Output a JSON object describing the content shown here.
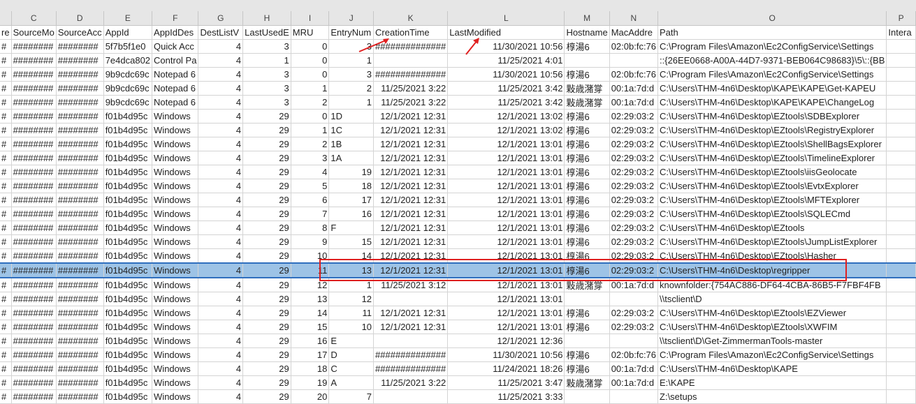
{
  "columns": [
    "",
    "C",
    "D",
    "E",
    "F",
    "G",
    "H",
    "I",
    "J",
    "K",
    "L",
    "M",
    "N",
    "O",
    "P"
  ],
  "headers": [
    "re",
    "SourceMo",
    "SourceAcc",
    "AppId",
    "AppIdDes",
    "DestListV",
    "LastUsedE",
    "MRU",
    "EntryNum",
    "CreationTime",
    "LastModified",
    "Hostname",
    "MacAddre",
    "Path",
    "Intera"
  ],
  "rows": [
    [
      "#",
      "########",
      "########",
      "5f7b5f1e0",
      "Quick Acc",
      "4",
      "3",
      "0",
      "3",
      "##############",
      "11/30/2021 10:56",
      "椁湯6",
      "02:0b:fc:76",
      "C:\\Program Files\\Amazon\\Ec2ConfigService\\Settings",
      ""
    ],
    [
      "#",
      "########",
      "########",
      "7e4dca802",
      "Control Pa",
      "4",
      "1",
      "0",
      "1",
      "",
      "11/25/2021 4:01",
      "",
      "",
      "::{26EE0668-A00A-44D7-9371-BEB064C98683}\\5\\::{BB",
      ""
    ],
    [
      "#",
      "########",
      "########",
      "9b9cdc69c",
      "Notepad 6",
      "4",
      "3",
      "0",
      "3",
      "##############",
      "11/30/2021 10:56",
      "椁湯6",
      "02:0b:fc:76",
      "C:\\Program Files\\Amazon\\Ec2ConfigService\\Settings",
      ""
    ],
    [
      "#",
      "########",
      "########",
      "9b9cdc69c",
      "Notepad 6",
      "4",
      "3",
      "1",
      "2",
      "11/25/2021 3:22",
      "11/25/2021 3:42",
      "敤歳潴牚",
      "00:1a:7d:d",
      "C:\\Users\\THM-4n6\\Desktop\\KAPE\\KAPE\\Get-KAPEU",
      ""
    ],
    [
      "#",
      "########",
      "########",
      "9b9cdc69c",
      "Notepad 6",
      "4",
      "3",
      "2",
      "1",
      "11/25/2021 3:22",
      "11/25/2021 3:42",
      "敤歳潴牚",
      "00:1a:7d:d",
      "C:\\Users\\THM-4n6\\Desktop\\KAPE\\KAPE\\ChangeLog",
      ""
    ],
    [
      "#",
      "########",
      "########",
      "f01b4d95c",
      "Windows",
      "4",
      "29",
      "0",
      "1D",
      "12/1/2021 12:31",
      "12/1/2021 13:02",
      "椁湯6",
      "02:29:03:2",
      "C:\\Users\\THM-4n6\\Desktop\\EZtools\\SDBExplorer",
      ""
    ],
    [
      "#",
      "########",
      "########",
      "f01b4d95c",
      "Windows",
      "4",
      "29",
      "1",
      "1C",
      "12/1/2021 12:31",
      "12/1/2021 13:02",
      "椁湯6",
      "02:29:03:2",
      "C:\\Users\\THM-4n6\\Desktop\\EZtools\\RegistryExplorer",
      ""
    ],
    [
      "#",
      "########",
      "########",
      "f01b4d95c",
      "Windows",
      "4",
      "29",
      "2",
      "1B",
      "12/1/2021 12:31",
      "12/1/2021 13:01",
      "椁湯6",
      "02:29:03:2",
      "C:\\Users\\THM-4n6\\Desktop\\EZtools\\ShellBagsExplorer",
      ""
    ],
    [
      "#",
      "########",
      "########",
      "f01b4d95c",
      "Windows",
      "4",
      "29",
      "3",
      "1A",
      "12/1/2021 12:31",
      "12/1/2021 13:01",
      "椁湯6",
      "02:29:03:2",
      "C:\\Users\\THM-4n6\\Desktop\\EZtools\\TimelineExplorer",
      ""
    ],
    [
      "#",
      "########",
      "########",
      "f01b4d95c",
      "Windows",
      "4",
      "29",
      "4",
      "19",
      "12/1/2021 12:31",
      "12/1/2021 13:01",
      "椁湯6",
      "02:29:03:2",
      "C:\\Users\\THM-4n6\\Desktop\\EZtools\\iisGeolocate",
      ""
    ],
    [
      "#",
      "########",
      "########",
      "f01b4d95c",
      "Windows",
      "4",
      "29",
      "5",
      "18",
      "12/1/2021 12:31",
      "12/1/2021 13:01",
      "椁湯6",
      "02:29:03:2",
      "C:\\Users\\THM-4n6\\Desktop\\EZtools\\EvtxExplorer",
      ""
    ],
    [
      "#",
      "########",
      "########",
      "f01b4d95c",
      "Windows",
      "4",
      "29",
      "6",
      "17",
      "12/1/2021 12:31",
      "12/1/2021 13:01",
      "椁湯6",
      "02:29:03:2",
      "C:\\Users\\THM-4n6\\Desktop\\EZtools\\MFTExplorer",
      ""
    ],
    [
      "#",
      "########",
      "########",
      "f01b4d95c",
      "Windows",
      "4",
      "29",
      "7",
      "16",
      "12/1/2021 12:31",
      "12/1/2021 13:01",
      "椁湯6",
      "02:29:03:2",
      "C:\\Users\\THM-4n6\\Desktop\\EZtools\\SQLECmd",
      ""
    ],
    [
      "#",
      "########",
      "########",
      "f01b4d95c",
      "Windows",
      "4",
      "29",
      "8",
      "F",
      "12/1/2021 12:31",
      "12/1/2021 13:01",
      "椁湯6",
      "02:29:03:2",
      "C:\\Users\\THM-4n6\\Desktop\\EZtools",
      ""
    ],
    [
      "#",
      "########",
      "########",
      "f01b4d95c",
      "Windows",
      "4",
      "29",
      "9",
      "15",
      "12/1/2021 12:31",
      "12/1/2021 13:01",
      "椁湯6",
      "02:29:03:2",
      "C:\\Users\\THM-4n6\\Desktop\\EZtools\\JumpListExplorer",
      ""
    ],
    [
      "#",
      "########",
      "########",
      "f01b4d95c",
      "Windows",
      "4",
      "29",
      "10",
      "14",
      "12/1/2021 12:31",
      "12/1/2021 13:01",
      "椁湯6",
      "02:29:03:2",
      "C:\\Users\\THM-4n6\\Desktop\\EZtools\\Hasher",
      ""
    ],
    [
      "#",
      "########",
      "########",
      "f01b4d95c",
      "Windows",
      "4",
      "29",
      "11",
      "13",
      "12/1/2021 12:31",
      "12/1/2021 13:01",
      "椁湯6",
      "02:29:03:2",
      "C:\\Users\\THM-4n6\\Desktop\\regripper",
      ""
    ],
    [
      "#",
      "########",
      "########",
      "f01b4d95c",
      "Windows",
      "4",
      "29",
      "12",
      "1",
      "11/25/2021 3:12",
      "12/1/2021 13:01",
      "敤歳潴牚",
      "00:1a:7d:d",
      "knownfolder:{754AC886-DF64-4CBA-86B5-F7FBF4FB",
      ""
    ],
    [
      "#",
      "########",
      "########",
      "f01b4d95c",
      "Windows",
      "4",
      "29",
      "13",
      "12",
      "",
      "12/1/2021 13:01",
      "",
      "",
      "\\\\tsclient\\D",
      ""
    ],
    [
      "#",
      "########",
      "########",
      "f01b4d95c",
      "Windows",
      "4",
      "29",
      "14",
      "11",
      "12/1/2021 12:31",
      "12/1/2021 13:01",
      "椁湯6",
      "02:29:03:2",
      "C:\\Users\\THM-4n6\\Desktop\\EZtools\\EZViewer",
      ""
    ],
    [
      "#",
      "########",
      "########",
      "f01b4d95c",
      "Windows",
      "4",
      "29",
      "15",
      "10",
      "12/1/2021 12:31",
      "12/1/2021 13:01",
      "椁湯6",
      "02:29:03:2",
      "C:\\Users\\THM-4n6\\Desktop\\EZtools\\XWFIM",
      ""
    ],
    [
      "#",
      "########",
      "########",
      "f01b4d95c",
      "Windows",
      "4",
      "29",
      "16",
      "E",
      "",
      "12/1/2021 12:36",
      "",
      "",
      "\\\\tsclient\\D\\Get-ZimmermanTools-master",
      ""
    ],
    [
      "#",
      "########",
      "########",
      "f01b4d95c",
      "Windows",
      "4",
      "29",
      "17",
      "D",
      "##############",
      "11/30/2021 10:56",
      "椁湯6",
      "02:0b:fc:76",
      "C:\\Program Files\\Amazon\\Ec2ConfigService\\Settings",
      ""
    ],
    [
      "#",
      "########",
      "########",
      "f01b4d95c",
      "Windows",
      "4",
      "29",
      "18",
      "C",
      "##############",
      "11/24/2021 18:26",
      "椁湯6",
      "00:1a:7d:d",
      "C:\\Users\\THM-4n6\\Desktop\\KAPE",
      ""
    ],
    [
      "#",
      "########",
      "########",
      "f01b4d95c",
      "Windows",
      "4",
      "29",
      "19",
      "A",
      "11/25/2021 3:22",
      "11/25/2021 3:47",
      "敤歳潴牚",
      "00:1a:7d:d",
      "E:\\KAPE",
      ""
    ],
    [
      "#",
      "########",
      "########",
      "f01b4d95c",
      "Windows",
      "4",
      "29",
      "20",
      "7",
      "",
      "11/25/2021 3:33",
      "",
      "",
      "Z:\\setups",
      ""
    ]
  ],
  "selected_row": 16,
  "accent": {
    "selection": "#9dc3e6",
    "selection_border": "#2f6fbe",
    "annotation": "#e02020"
  }
}
